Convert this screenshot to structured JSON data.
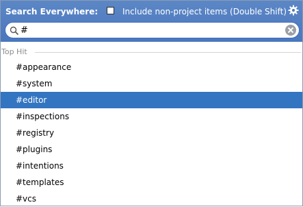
{
  "header": {
    "title": "Search Everywhere:",
    "include_label": "Include non-project items (Double Shift)",
    "include_checked": false
  },
  "search": {
    "value": "#"
  },
  "group": {
    "label": "Top Hit"
  },
  "results": [
    {
      "label": "#appearance",
      "selected": false
    },
    {
      "label": "#system",
      "selected": false
    },
    {
      "label": "#editor",
      "selected": true
    },
    {
      "label": "#inspections",
      "selected": false
    },
    {
      "label": "#registry",
      "selected": false
    },
    {
      "label": "#plugins",
      "selected": false
    },
    {
      "label": "#intentions",
      "selected": false
    },
    {
      "label": "#templates",
      "selected": false
    },
    {
      "label": "#vcs",
      "selected": false
    }
  ],
  "colors": {
    "header_bg": "#4a77bd",
    "selection_bg": "#3375c0",
    "search_border": "#3d6cc4"
  },
  "icons": {
    "settings": "gear-icon",
    "search": "search-icon",
    "clear": "clear-icon"
  }
}
